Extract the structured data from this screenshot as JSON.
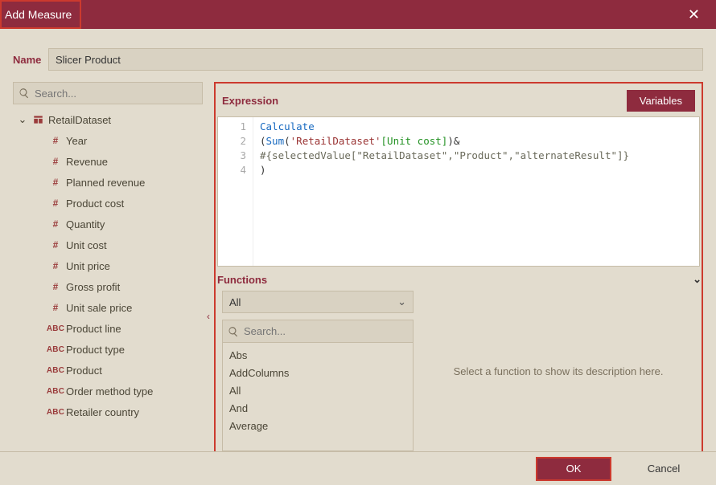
{
  "title": "Add Measure",
  "name_label": "Name",
  "name_value": "Slicer Product",
  "left_search_placeholder": "Search...",
  "dataset_name": "RetailDataset",
  "fields": [
    {
      "label": "Year",
      "kind": "num"
    },
    {
      "label": "Revenue",
      "kind": "num"
    },
    {
      "label": "Planned revenue",
      "kind": "num"
    },
    {
      "label": "Product cost",
      "kind": "num"
    },
    {
      "label": "Quantity",
      "kind": "num"
    },
    {
      "label": "Unit cost",
      "kind": "num"
    },
    {
      "label": "Unit price",
      "kind": "num"
    },
    {
      "label": "Gross profit",
      "kind": "num"
    },
    {
      "label": "Unit sale price",
      "kind": "num"
    },
    {
      "label": "Product line",
      "kind": "abc"
    },
    {
      "label": "Product type",
      "kind": "abc"
    },
    {
      "label": "Product",
      "kind": "abc"
    },
    {
      "label": "Order method type",
      "kind": "abc"
    },
    {
      "label": "Retailer country",
      "kind": "abc"
    }
  ],
  "expression_label": "Expression",
  "variables_label": "Variables",
  "code": {
    "l1_calculate": "Calculate",
    "l2_pre": "(",
    "l2_sum": "Sum",
    "l2_open": "(",
    "l2_tbl": "'RetailDataset'",
    "l2_col": "[Unit cost]",
    "l2_close": ")&",
    "l3": "#{selectedValue[\"RetailDataset\",\"Product\",\"alternateResult\"]}",
    "l4": ")"
  },
  "functions_label": "Functions",
  "functions_filter": "All",
  "functions_search_placeholder": "Search...",
  "function_list": [
    "Abs",
    "AddColumns",
    "All",
    "And",
    "Average"
  ],
  "functions_hint": "Select a function to show its description here.",
  "ok_label": "OK",
  "cancel_label": "Cancel"
}
